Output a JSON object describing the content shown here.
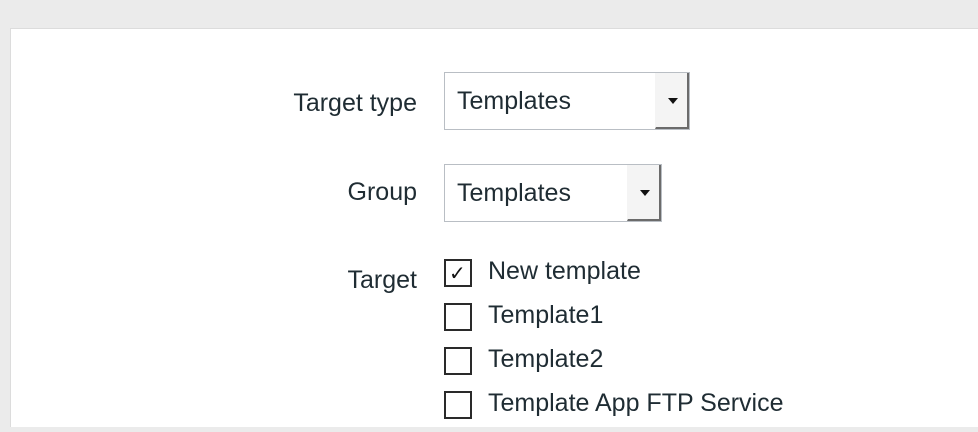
{
  "form": {
    "target_type": {
      "label": "Target type",
      "value": "Templates"
    },
    "group": {
      "label": "Group",
      "value": "Templates"
    },
    "target": {
      "label": "Target",
      "items": [
        {
          "label": "New template",
          "checked": true
        },
        {
          "label": "Template1",
          "checked": false
        },
        {
          "label": "Template2",
          "checked": false
        },
        {
          "label": "Template App FTP Service",
          "checked": false
        }
      ]
    }
  },
  "icons": {
    "dropdown": "triangle-down-icon",
    "check": "checkmark-icon"
  },
  "colors": {
    "page_background": "#ebebeb",
    "panel_background": "#ffffff",
    "text": "#1f2c33",
    "control_border": "#b9bec4"
  }
}
